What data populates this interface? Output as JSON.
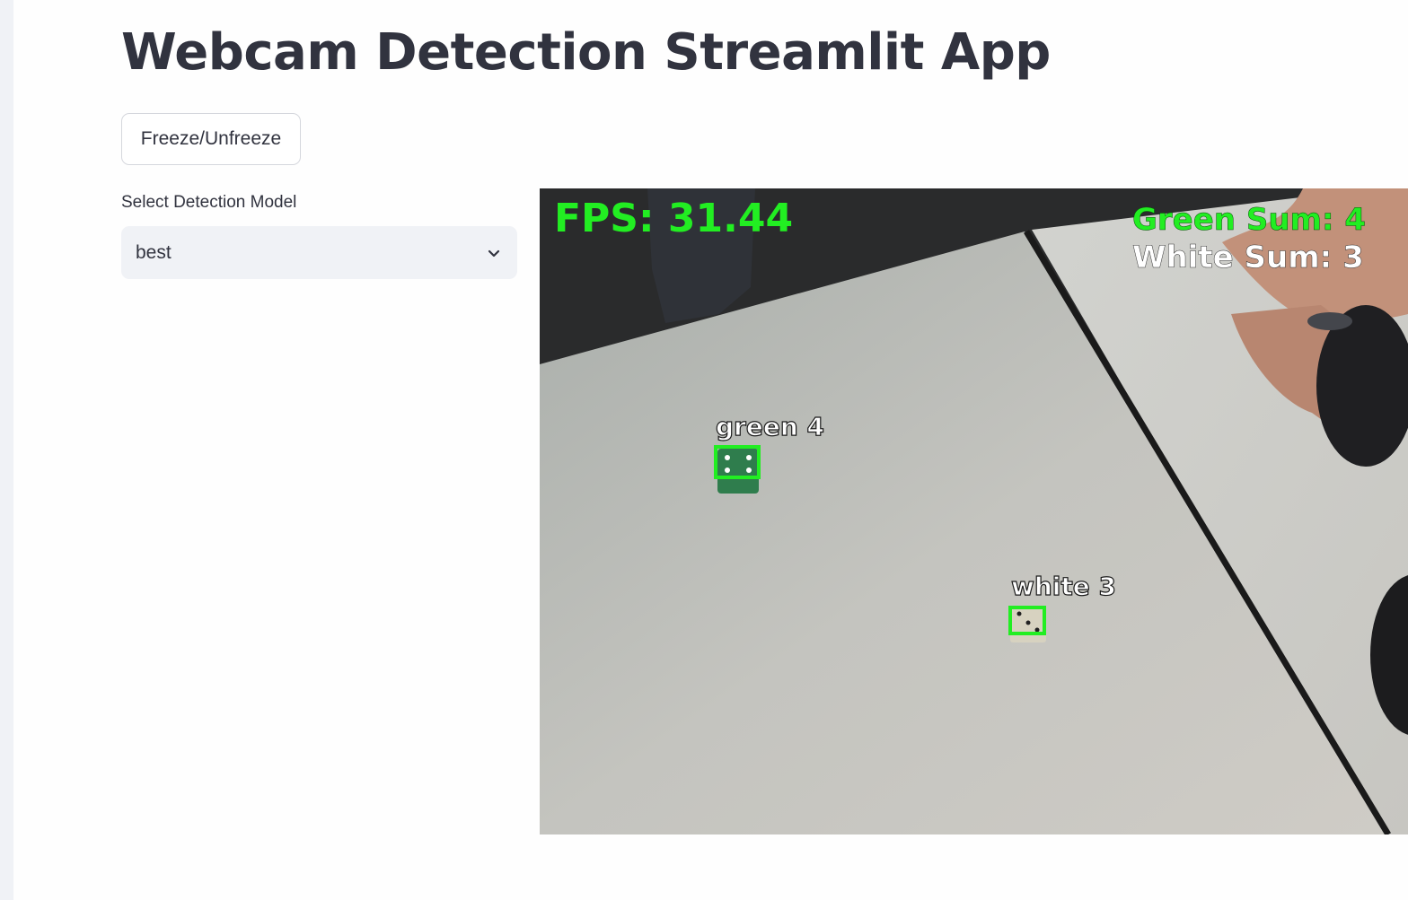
{
  "app": {
    "title": "Webcam Detection Streamlit App"
  },
  "controls": {
    "freeze_button_label": "Freeze/Unfreeze",
    "model_select": {
      "label": "Select Detection Model",
      "selected": "best"
    }
  },
  "video": {
    "fps_text": "FPS: 31.44",
    "green_sum_text": "Green  Sum:  4",
    "white_sum_text": "White  Sum:  3",
    "detections": [
      {
        "label": "green  4"
      },
      {
        "label": "white  3"
      }
    ],
    "colors": {
      "overlay_green": "#22ee22",
      "overlay_white": "#ffffff",
      "box_color": "#22ee22"
    }
  },
  "icons": {
    "dropdown": "chevron-down-icon"
  }
}
